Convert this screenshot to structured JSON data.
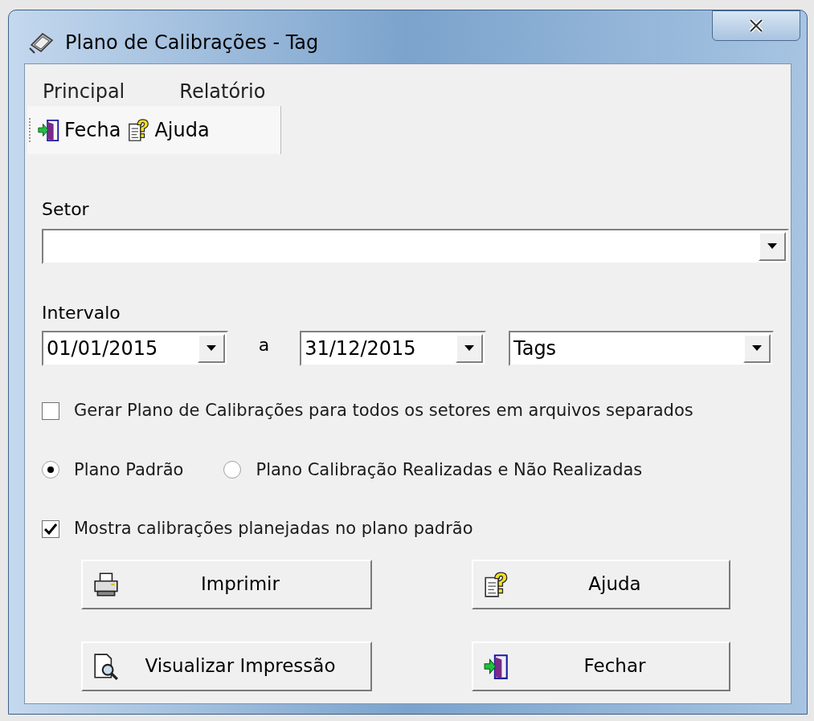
{
  "window": {
    "title": "Plano de Calibrações - Tag"
  },
  "menu": [
    {
      "label": "Principal"
    },
    {
      "label": "Relatório"
    }
  ],
  "toolbar": [
    {
      "label": "Fecha",
      "kind": "exit"
    },
    {
      "label": "Ajuda",
      "kind": "help"
    }
  ],
  "setor": {
    "label": "Setor"
  },
  "intervalo": {
    "label": "Intervalo",
    "from": "01/01/2015",
    "separator": "a",
    "to": "31/12/2015",
    "type": "Tags"
  },
  "separate_files": {
    "label": "Gerar Plano de Calibrações para todos os setores em arquivos separados",
    "checked": false
  },
  "plans": [
    {
      "label": "Plano Padrão",
      "selected": true
    },
    {
      "label": "Plano Calibração Realizadas e Não Realizadas",
      "selected": false
    }
  ],
  "show_planned": {
    "label": "Mostra calibrações planejadas no plano padrão",
    "checked": true
  },
  "buttons": [
    {
      "label": "Imprimir",
      "kind": "print"
    },
    {
      "label": "Ajuda",
      "kind": "help"
    },
    {
      "label": "Visualizar Impressão",
      "kind": "preview"
    },
    {
      "label": "Fechar",
      "kind": "exit"
    }
  ]
}
